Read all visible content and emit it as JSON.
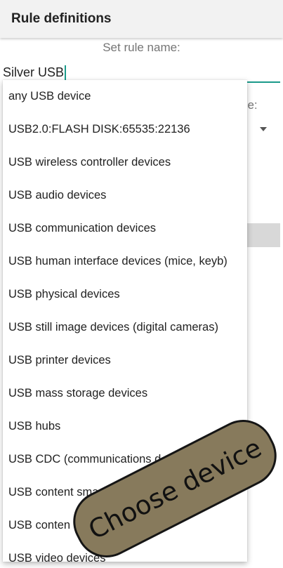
{
  "appbar": {
    "title": "Rule definitions"
  },
  "form": {
    "rule_name_label": "Set rule name:",
    "rule_name_value": "Silver USB",
    "type_label_partial": "pe:"
  },
  "dropdown": {
    "items": [
      "any USB device",
      "USB2.0:FLASH DISK:65535:22136",
      "USB wireless controller devices",
      "USB audio devices",
      "USB communication devices",
      "USB human interface devices (mice, keyb)",
      "USB physical devices",
      "USB still image devices (digital cameras)",
      "USB printer devices",
      "USB mass storage devices",
      "USB hubs",
      "USB CDC (communications d",
      "USB content smart",
      "USB conten         ices",
      "USB video devices"
    ]
  },
  "badge": {
    "text": "Choose device"
  },
  "colors": {
    "accent": "#1a9a8a",
    "badge_fill": "#877a5c"
  }
}
